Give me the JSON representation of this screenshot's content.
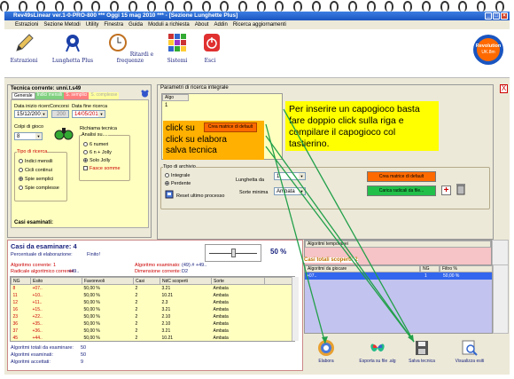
{
  "window": {
    "title": "Rev49sLinear ver.1-0-PRO-800  ***  Oggi 15 mag 2010  ***  - [Sezione Lunghette Plus]"
  },
  "menu": [
    "Estrazioni",
    "Sezione Metodi",
    "Utility",
    "Finestra",
    "Guida",
    "Moduli a richiesta",
    "About",
    "Addin",
    "Ricerca aggiornamenti"
  ],
  "toolbar": {
    "estrazioni": "Estrazioni",
    "lunghette": "Lunghetta Plus",
    "ritardi": "Ritardi e frequenze",
    "sistemi": "Sistemi",
    "esci": "Esci",
    "brand_line1": "Revolution",
    "brand_line2": "UK.8m"
  },
  "tecnica": {
    "title": "Tecnica corrente: unni.t.s49",
    "tabs": [
      "Generale",
      "Indici mensili",
      "S. semplici",
      "S. complesse"
    ],
    "data_inizio_label": "Data inizio ricerca",
    "data_inizio": "15/12/2009",
    "concorsi_label": "Concorsi",
    "concorsi": "200",
    "data_fine_label": "Data fine ricerca",
    "data_fine": "14/05/2010",
    "colpi_label": "Colpi di gioco",
    "colpi": "8",
    "richiama_label": "Richiama tecnica",
    "analisi_label": "Analisi su....",
    "analisi_opts": [
      "6 numeri",
      "6 n + Jolly",
      "Solo Jolly"
    ],
    "fasce_label": "Fasce somme",
    "tipo_label": "Tipo di ricerca",
    "tipo_opts": [
      "Indici mensili",
      "Cicli continui",
      "Spie semplici",
      "Spie complesse"
    ],
    "casi_label": "Casi esaminati:"
  },
  "parametri": {
    "title": "Parametri di ricerca integrale",
    "algo_hdr": "Algo",
    "algo_val": "1",
    "hint": "Per inserire un capogioco basta fare doppio click sulla riga e compilare il capogioco col tastierino.",
    "orange_lines": [
      "click su",
      "click su elabora",
      "salva tecnica"
    ],
    "crea_small": "Crea matrice di default"
  },
  "archivio": {
    "title": "Tipo di archivio",
    "opts": [
      "Integrale",
      "Perdente"
    ],
    "lunghetta_label": "Lunghetta da",
    "lunghetta_val": "1",
    "sorte_label": "Sorte minima",
    "sorte_val": "Ambata",
    "reset": "Reset ultimo processo",
    "crea_btn": "Crea matrice di default",
    "carica_btn": "Carica radicali da file..."
  },
  "casi": {
    "title": "Casi da esaminare: 4",
    "perc_label": "Percentuale di elaborazione:",
    "perc_val": "Finito!",
    "percent": "50 %",
    "alg_corr": "Algoritmo corrente: 1",
    "alg_esam": "Algoritmo esaminato:",
    "alg_esam_val": "(49) # +49..",
    "radicale": "Radicale algoritmico corrente:",
    "radicale_val": "+49..",
    "dimensione": "Dimensione corrente:",
    "dimensione_val": "D2",
    "tot_label": "Algoritmi totali da esaminare:",
    "tot_val": "50",
    "esam_label": "Algoritmi esaminati:",
    "esam_val": "50",
    "acc_label": "Algoritmi accettati:",
    "acc_val": "9"
  },
  "table": {
    "headers": [
      "NG",
      "Esito",
      "Favorevoli",
      "Casi",
      "NdC scoperti",
      "Sorte"
    ],
    "rows": [
      [
        "8",
        "+07..",
        "50,00 %",
        "2",
        "3.21",
        "Ambata"
      ],
      [
        "11",
        "+10..",
        "50,00 %",
        "2",
        "10.21",
        "Ambata"
      ],
      [
        "12",
        "+11..",
        "50,00 %",
        "2",
        "2.3",
        "Ambata"
      ],
      [
        "16",
        "+15..",
        "50,00 %",
        "2",
        "3.21",
        "Ambata"
      ],
      [
        "23",
        "+22..",
        "50,00 %",
        "2",
        "2.10",
        "Ambata"
      ],
      [
        "36",
        "+35..",
        "50,00 %",
        "2",
        "2.10",
        "Ambata"
      ],
      [
        "37",
        "+36..",
        "50,00 %",
        "2",
        "3.21",
        "Ambata"
      ],
      [
        "45",
        "+44..",
        "50,00 %",
        "2",
        "10.21",
        "Ambata"
      ],
      [
        "",
        "+00",
        "25.00 %",
        "1",
        "2.10.21",
        "Ambata"
      ]
    ]
  },
  "temporanei": {
    "title": "Algoritmi temporanei"
  },
  "scoperti": {
    "title": "Casi totali scoperti: 2",
    "headers": [
      "Algoritmi da giocare",
      "NG",
      "Filtro %"
    ],
    "row": [
      "+07..",
      "1",
      "50,00 %"
    ]
  },
  "bottom": {
    "elabora": "Elabora",
    "esporta": "Esporta su file .alg",
    "salva": "Salva tecnica",
    "visualizza": "Visualizza esiti"
  },
  "colors": {
    "accent": "#1a55c0",
    "hint_yellow": "#ffff00",
    "orange": "#ffb000"
  }
}
